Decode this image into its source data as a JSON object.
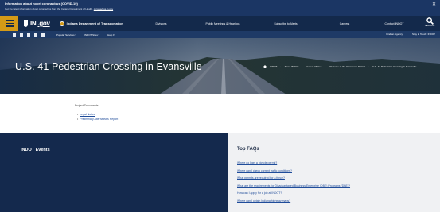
{
  "alert": {
    "title": "Information about novel coronavirus (COVID-19)",
    "text": "Get the latest information about coronavirus from the Indiana Department of Health,",
    "link": "coronavirus.in.gov",
    "close_icon": "close-icon"
  },
  "topnav": {
    "menu_icon": "hamburger-icon",
    "logo_text_in": "IN",
    "logo_text_gov": ".gov",
    "agency": "Indiana Department of Transportation",
    "items": [
      "Divisions",
      "Public Meetings & Hearings",
      "Subscribe to Alerts",
      "Careers",
      "Contact INDOT"
    ],
    "search_label": "SEARCH"
  },
  "subnav": {
    "share_icons": [
      "facebook-icon",
      "twitter-icon",
      "youtube-icon",
      "email-icon",
      "print-icon"
    ],
    "dropdowns": [
      "Popular Services ▾",
      "INDOT Sites ▾",
      "Help ▾"
    ],
    "right_links": [
      "Find an Agency",
      "Stay in Touch: INDOT"
    ]
  },
  "hero": {
    "title": "U.S. 41 Pedestrian Crossing in Evansville",
    "breadcrumbs": [
      "INDOT",
      "About INDOT",
      "Current Offices",
      "Welcome to the Vincennes District",
      "U.S. 41 Pedestrian Crossing in Evansville"
    ],
    "home_icon": "home-icon"
  },
  "content": {
    "heading": "Project Documents",
    "links": [
      "Legal Notice",
      "Preliminary Alternatives Report"
    ]
  },
  "events": {
    "title": "INDOT Events"
  },
  "faqs": {
    "title": "Top FAQs",
    "items": [
      "Where do I get a bicycle permit?",
      "Where can I check current traffic conditions?",
      "What permits are required for a fence?",
      "What are the requirements for Disadvantaged Business Enterprise (DBE) Programs (DBE)?",
      "How can I apply for a job at INDOT?",
      "Where can I obtain Indiana highway maps?"
    ]
  }
}
